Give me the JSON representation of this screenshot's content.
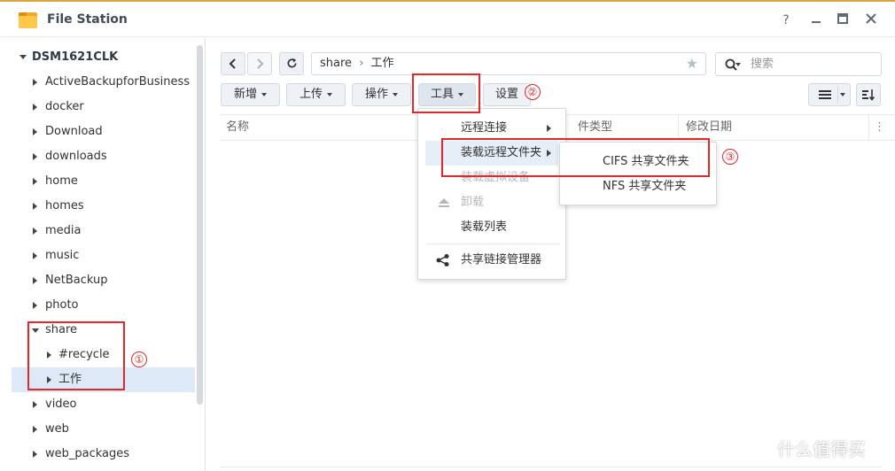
{
  "window": {
    "title": "File Station",
    "help": "?",
    "minimize": "−",
    "maximize": "▣",
    "close": "✕"
  },
  "sidebar": {
    "root": "DSM1621CLK",
    "items": [
      {
        "label": "ActiveBackupforBusiness"
      },
      {
        "label": "docker"
      },
      {
        "label": "Download"
      },
      {
        "label": "downloads"
      },
      {
        "label": "home"
      },
      {
        "label": "homes"
      },
      {
        "label": "media"
      },
      {
        "label": "music"
      },
      {
        "label": "NetBackup"
      },
      {
        "label": "photo"
      },
      {
        "label": "share"
      },
      {
        "label": "#recycle"
      },
      {
        "label": "工作"
      },
      {
        "label": "video"
      },
      {
        "label": "web"
      },
      {
        "label": "web_packages"
      }
    ]
  },
  "toolbar": {
    "path_root": "share",
    "path_sep": "›",
    "path_current": "工作",
    "search_placeholder": "搜索",
    "new_label": "新增",
    "upload_label": "上传",
    "action_label": "操作",
    "tools_label": "工具",
    "settings_label": "设置"
  },
  "table": {
    "col_name": "名称",
    "col_type": "件类型",
    "col_modified": "修改日期"
  },
  "tools_menu": {
    "remote_connect": "远程连接",
    "mount_remote_folder": "装载远程文件夹",
    "mount_virtual_drive": "装载虚拟设备",
    "unmount": "卸载",
    "mount_list": "装载列表",
    "share_link_manager": "共享链接管理器"
  },
  "submenu": {
    "cifs": "CIFS 共享文件夹",
    "nfs": "NFS 共享文件夹"
  },
  "annotations": {
    "one": "①",
    "two": "②",
    "three": "③"
  },
  "watermark": "什么值得买",
  "colors": {
    "accent_red": "#e5262a",
    "selection": "#dde9f6",
    "button_bg": "#eef1f5"
  }
}
